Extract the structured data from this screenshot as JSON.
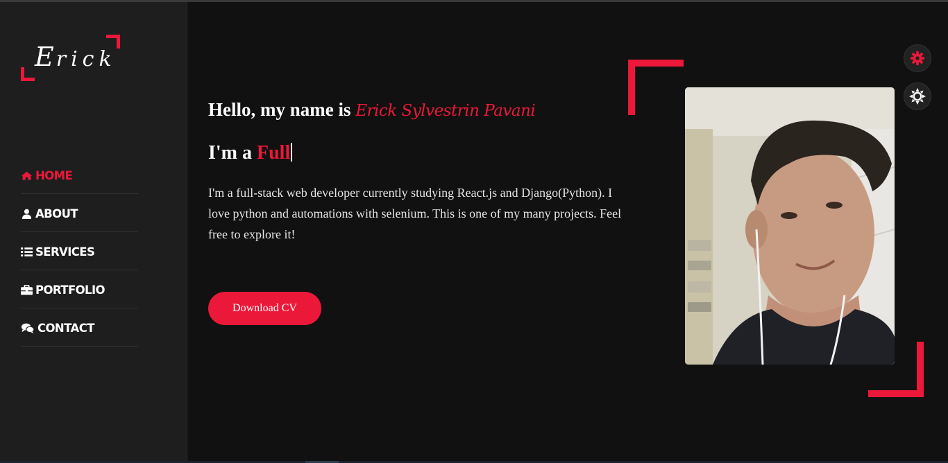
{
  "brand": {
    "logo_initial": "E",
    "logo_rest": "rick",
    "accent_color": "#ec1839"
  },
  "nav": {
    "items": [
      {
        "label": "HOME",
        "icon": "home-icon",
        "active": true
      },
      {
        "label": "ABOUT",
        "icon": "user-icon",
        "active": false
      },
      {
        "label": "SERVICES",
        "icon": "list-icon",
        "active": false
      },
      {
        "label": "PORTFOLIO",
        "icon": "briefcase-icon",
        "active": false
      },
      {
        "label": "CONTACT",
        "icon": "comments-icon",
        "active": false
      }
    ]
  },
  "hero": {
    "greeting": "Hello, my name is",
    "name": "Erick Sylvestrin Pavani",
    "prefix": "I'm a",
    "role_typed": "Full",
    "description": "I'm a full-stack web developer currently studying React.js and Django(Python). I love python and automations with selenium. This is one of my many projects. Feel free to explore it!",
    "cta": "Download CV"
  },
  "photo": {
    "icon": "profile-photo"
  },
  "toggles": {
    "style_switcher_icon": "gear-icon",
    "day_night_icon": "sun-icon"
  }
}
